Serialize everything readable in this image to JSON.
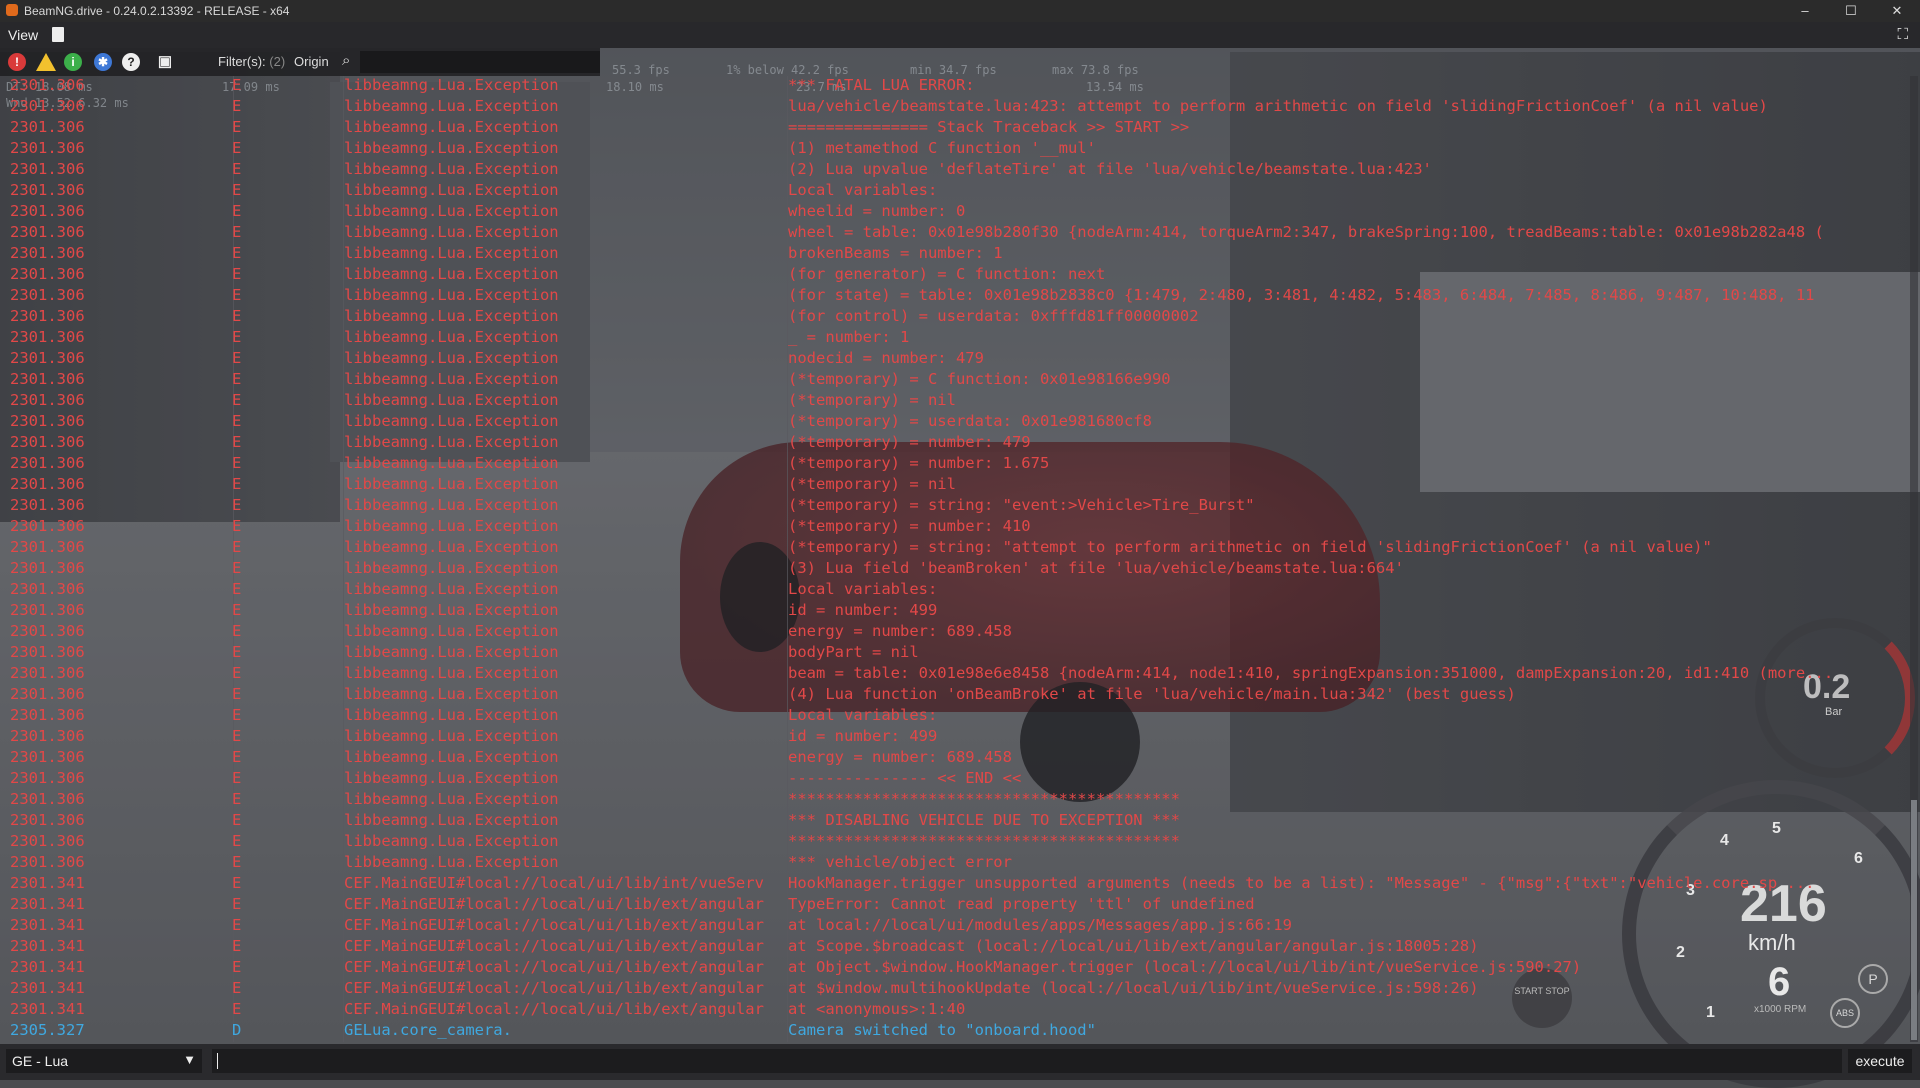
{
  "window": {
    "title": "BeamNG.drive - 0.24.0.2.13392 - RELEASE - x64",
    "minimize": "–",
    "maximize": "☐",
    "close": "✕"
  },
  "menu": {
    "view_label": "View",
    "expand": "⛶"
  },
  "toolbar": {
    "filter_label": "Filter(s):",
    "filter_count": "(2)",
    "origin_label": "Origin"
  },
  "fps": {
    "stats": [
      "55.3 fps",
      "1% below  42.2 fps",
      "min  34.7 fps",
      "max  73.8 fps"
    ],
    "dt": [
      "DT:  18.08 ms",
      "17.09 ms",
      "18.10 ms",
      "23.7 ms",
      "13.54 ms"
    ],
    "dt2": "Wnd 13.52  6.32 ms"
  },
  "log": {
    "rows": [
      {
        "time": "2301.306",
        "level": "E",
        "origin": "libbeamng.Lua.Exception",
        "message": "*** FATAL LUA ERROR: ",
        "type": "err"
      },
      {
        "time": "2301.306",
        "level": "E",
        "origin": "libbeamng.Lua.Exception",
        "message": "lua/vehicle/beamstate.lua:423: attempt to perform arithmetic on field 'slidingFrictionCoef' (a nil value)",
        "type": "err"
      },
      {
        "time": "2301.306",
        "level": "E",
        "origin": "libbeamng.Lua.Exception",
        "message": "=============== Stack Traceback >> START >>",
        "type": "err"
      },
      {
        "time": "2301.306",
        "level": "E",
        "origin": "libbeamng.Lua.Exception",
        "message": "(1) metamethod C function '__mul'",
        "type": "err"
      },
      {
        "time": "2301.306",
        "level": "E",
        "origin": "libbeamng.Lua.Exception",
        "message": "(2) Lua upvalue 'deflateTire' at file 'lua/vehicle/beamstate.lua:423'",
        "type": "err"
      },
      {
        "time": "2301.306",
        "level": "E",
        "origin": "libbeamng.Lua.Exception",
        "message": "  Local variables:",
        "type": "err"
      },
      {
        "time": "2301.306",
        "level": "E",
        "origin": "libbeamng.Lua.Exception",
        "message": "  wheelid = number: 0",
        "type": "err"
      },
      {
        "time": "2301.306",
        "level": "E",
        "origin": "libbeamng.Lua.Exception",
        "message": "  wheel = table: 0x01e98b280f30  {nodeArm:414, torqueArm2:347, brakeSpring:100, treadBeams:table: 0x01e98b282a48 (",
        "type": "err"
      },
      {
        "time": "2301.306",
        "level": "E",
        "origin": "libbeamng.Lua.Exception",
        "message": "  brokenBeams = number: 1",
        "type": "err"
      },
      {
        "time": "2301.306",
        "level": "E",
        "origin": "libbeamng.Lua.Exception",
        "message": "  (for generator) = C function: next",
        "type": "err"
      },
      {
        "time": "2301.306",
        "level": "E",
        "origin": "libbeamng.Lua.Exception",
        "message": "  (for state) = table: 0x01e98b2838c0  {1:479, 2:480, 3:481, 4:482, 5:483, 6:484, 7:485, 8:486, 9:487, 10:488, 11",
        "type": "err"
      },
      {
        "time": "2301.306",
        "level": "E",
        "origin": "libbeamng.Lua.Exception",
        "message": "  (for control) = userdata: 0xfffd81ff00000002",
        "type": "err"
      },
      {
        "time": "2301.306",
        "level": "E",
        "origin": "libbeamng.Lua.Exception",
        "message": "  _ = number: 1",
        "type": "err"
      },
      {
        "time": "2301.306",
        "level": "E",
        "origin": "libbeamng.Lua.Exception",
        "message": "  nodecid = number: 479",
        "type": "err"
      },
      {
        "time": "2301.306",
        "level": "E",
        "origin": "libbeamng.Lua.Exception",
        "message": "  (*temporary) = C function: 0x01e98166e990",
        "type": "err"
      },
      {
        "time": "2301.306",
        "level": "E",
        "origin": "libbeamng.Lua.Exception",
        "message": "  (*temporary) = nil",
        "type": "err"
      },
      {
        "time": "2301.306",
        "level": "E",
        "origin": "libbeamng.Lua.Exception",
        "message": "  (*temporary) = userdata: 0x01e981680cf8",
        "type": "err"
      },
      {
        "time": "2301.306",
        "level": "E",
        "origin": "libbeamng.Lua.Exception",
        "message": "  (*temporary) = number: 479",
        "type": "err"
      },
      {
        "time": "2301.306",
        "level": "E",
        "origin": "libbeamng.Lua.Exception",
        "message": "  (*temporary) = number: 1.675",
        "type": "err"
      },
      {
        "time": "2301.306",
        "level": "E",
        "origin": "libbeamng.Lua.Exception",
        "message": "  (*temporary) = nil",
        "type": "err"
      },
      {
        "time": "2301.306",
        "level": "E",
        "origin": "libbeamng.Lua.Exception",
        "message": "  (*temporary) = string: \"event:>Vehicle>Tire_Burst\"",
        "type": "err"
      },
      {
        "time": "2301.306",
        "level": "E",
        "origin": "libbeamng.Lua.Exception",
        "message": "  (*temporary) = number: 410",
        "type": "err"
      },
      {
        "time": "2301.306",
        "level": "E",
        "origin": "libbeamng.Lua.Exception",
        "message": "  (*temporary) = string: \"attempt to perform arithmetic on field 'slidingFrictionCoef' (a nil value)\"",
        "type": "err"
      },
      {
        "time": "2301.306",
        "level": "E",
        "origin": "libbeamng.Lua.Exception",
        "message": "(3) Lua field 'beamBroken' at file 'lua/vehicle/beamstate.lua:664'",
        "type": "err"
      },
      {
        "time": "2301.306",
        "level": "E",
        "origin": "libbeamng.Lua.Exception",
        "message": "  Local variables:",
        "type": "err"
      },
      {
        "time": "2301.306",
        "level": "E",
        "origin": "libbeamng.Lua.Exception",
        "message": "  id = number: 499",
        "type": "err"
      },
      {
        "time": "2301.306",
        "level": "E",
        "origin": "libbeamng.Lua.Exception",
        "message": "  energy = number: 689.458",
        "type": "err"
      },
      {
        "time": "2301.306",
        "level": "E",
        "origin": "libbeamng.Lua.Exception",
        "message": "  bodyPart = nil",
        "type": "err"
      },
      {
        "time": "2301.306",
        "level": "E",
        "origin": "libbeamng.Lua.Exception",
        "message": "  beam = table: 0x01e98e6e8458  {nodeArm:414, node1:410, springExpansion:351000, dampExpansion:20, id1:410 (more...",
        "type": "err"
      },
      {
        "time": "2301.306",
        "level": "E",
        "origin": "libbeamng.Lua.Exception",
        "message": "(4) Lua function 'onBeamBroke' at file 'lua/vehicle/main.lua:342' (best guess)",
        "type": "err"
      },
      {
        "time": "2301.306",
        "level": "E",
        "origin": "libbeamng.Lua.Exception",
        "message": "  Local variables:",
        "type": "err"
      },
      {
        "time": "2301.306",
        "level": "E",
        "origin": "libbeamng.Lua.Exception",
        "message": "  id = number: 499",
        "type": "err"
      },
      {
        "time": "2301.306",
        "level": "E",
        "origin": "libbeamng.Lua.Exception",
        "message": "  energy = number: 689.458",
        "type": "err"
      },
      {
        "time": "2301.306",
        "level": "E",
        "origin": "libbeamng.Lua.Exception",
        "message": "--------------- << END <<",
        "type": "err"
      },
      {
        "time": "2301.306",
        "level": "E",
        "origin": "libbeamng.Lua.Exception",
        "message": "******************************************",
        "type": "err"
      },
      {
        "time": "2301.306",
        "level": "E",
        "origin": "libbeamng.Lua.Exception",
        "message": "*** DISABLING VEHICLE DUE TO EXCEPTION ***",
        "type": "err"
      },
      {
        "time": "2301.306",
        "level": "E",
        "origin": "libbeamng.Lua.Exception",
        "message": "******************************************",
        "type": "err"
      },
      {
        "time": "2301.306",
        "level": "E",
        "origin": "libbeamng.Lua.Exception",
        "message": "*** vehicle/object error",
        "type": "err"
      },
      {
        "time": "2301.341",
        "level": "E",
        "origin": "CEF.MainGEUI#local://local/ui/lib/int/vueServ",
        "message": "HookManager.trigger unsupported arguments (needs to be a list): \"Message\" - {\"msg\":{\"txt\":\"vehicle.core.sp ...",
        "type": "err"
      },
      {
        "time": "2301.341",
        "level": "E",
        "origin": "CEF.MainGEUI#local://local/ui/lib/ext/angular",
        "message": "TypeError: Cannot read property 'ttl' of undefined",
        "type": "err"
      },
      {
        "time": "2301.341",
        "level": "E",
        "origin": "CEF.MainGEUI#local://local/ui/lib/ext/angular",
        "message": "    at local://local/ui/modules/apps/Messages/app.js:66:19",
        "type": "err"
      },
      {
        "time": "2301.341",
        "level": "E",
        "origin": "CEF.MainGEUI#local://local/ui/lib/ext/angular",
        "message": "    at Scope.$broadcast (local://local/ui/lib/ext/angular/angular.js:18005:28)",
        "type": "err"
      },
      {
        "time": "2301.341",
        "level": "E",
        "origin": "CEF.MainGEUI#local://local/ui/lib/ext/angular",
        "message": "    at Object.$window.HookManager.trigger (local://local/ui/lib/int/vueService.js:590:27)",
        "type": "err"
      },
      {
        "time": "2301.341",
        "level": "E",
        "origin": "CEF.MainGEUI#local://local/ui/lib/ext/angular",
        "message": "    at $window.multihookUpdate (local://local/ui/lib/int/vueService.js:598:26)",
        "type": "err"
      },
      {
        "time": "2301.341",
        "level": "E",
        "origin": "CEF.MainGEUI#local://local/ui/lib/ext/angular",
        "message": "    at <anonymous>:1:40",
        "type": "err"
      },
      {
        "time": "2305.327",
        "level": "D",
        "origin": "GELua.core_camera.",
        "message": "Camera switched to \"onboard.hood\"",
        "type": "dbg"
      }
    ]
  },
  "input": {
    "context": "GE - Lua",
    "execute_label": "execute"
  },
  "hud": {
    "small_gauge_value": "0.2",
    "small_gauge_unit": "Bar",
    "speed": "216",
    "speed_unit": "km/h",
    "gear": "6",
    "rpm_label": "x1000 RPM",
    "gear_marks": [
      "1",
      "2",
      "3",
      "4",
      "5",
      "6"
    ],
    "start_stop": "START STOP",
    "park": "P",
    "abs": "ABS"
  },
  "colors": {
    "error": "#e24848",
    "debug": "#3fa8e0"
  }
}
